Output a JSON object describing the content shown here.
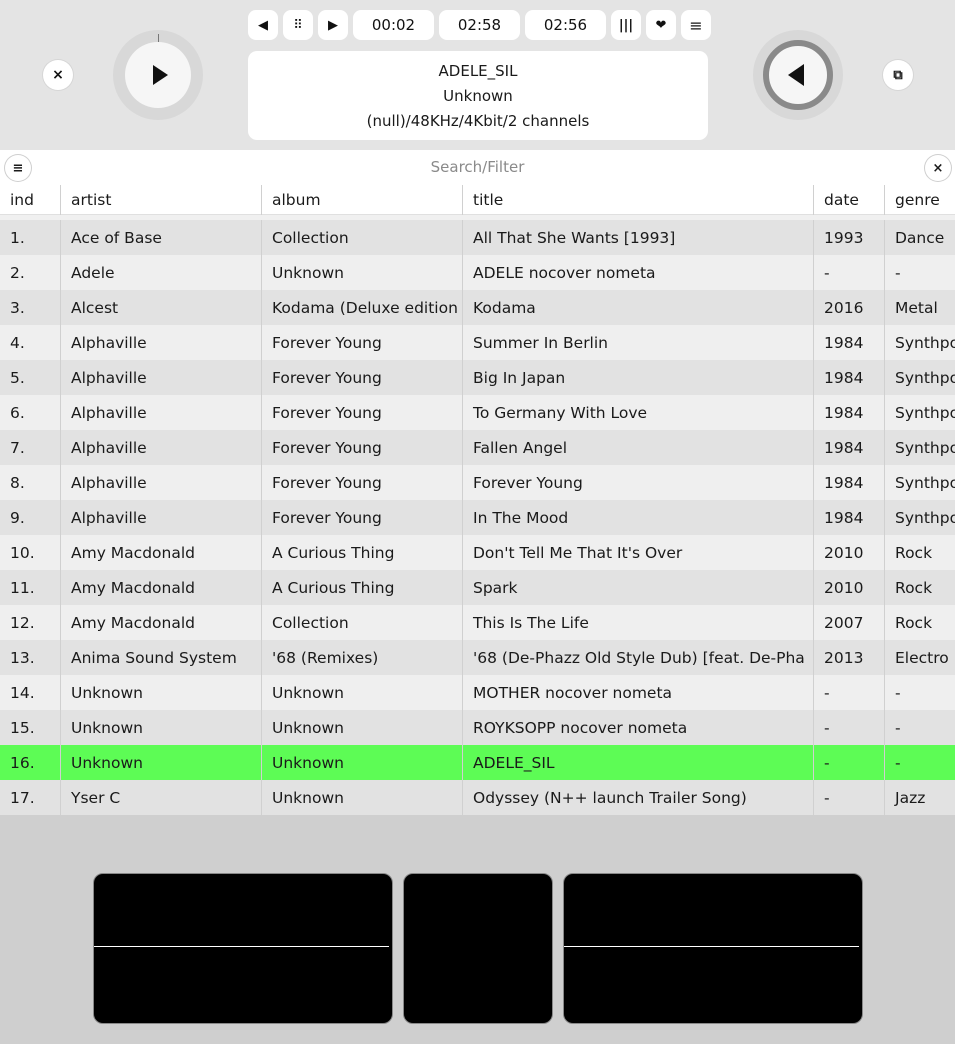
{
  "player": {
    "times": {
      "elapsed": "00:02",
      "total": "02:58",
      "remaining": "02:56"
    },
    "track_title": "ADELE_SIL",
    "track_album": "Unknown",
    "track_format": "(null)/48KHz/4Kbit/2 channels",
    "icons": {
      "close": "×",
      "prev": "◀",
      "drag": "⠿",
      "next": "▶",
      "bars": "|||",
      "heart": "❤",
      "menu": "≡",
      "window": "⧉"
    }
  },
  "search": {
    "placeholder": "Search/Filter",
    "menu_icon": "≡",
    "clear_icon": "×"
  },
  "table": {
    "columns": [
      "ind",
      "artist",
      "album",
      "title",
      "date",
      "genre"
    ],
    "rows": [
      {
        "ind": "1.",
        "artist": "Ace of Base",
        "album": "Collection",
        "title": "All That She Wants [1993]",
        "date": "1993",
        "genre": "Dance"
      },
      {
        "ind": "2.",
        "artist": "Adele",
        "album": "Unknown",
        "title": "ADELE nocover nometa",
        "date": "-",
        "genre": "-"
      },
      {
        "ind": "3.",
        "artist": "Alcest",
        "album": "Kodama (Deluxe edition",
        "title": "Kodama",
        "date": "2016",
        "genre": "Metal"
      },
      {
        "ind": "4.",
        "artist": "Alphaville",
        "album": "Forever Young",
        "title": "Summer In Berlin",
        "date": "1984",
        "genre": "Synthpo"
      },
      {
        "ind": "5.",
        "artist": "Alphaville",
        "album": "Forever Young",
        "title": "Big In Japan",
        "date": "1984",
        "genre": "Synthpo"
      },
      {
        "ind": "6.",
        "artist": "Alphaville",
        "album": "Forever Young",
        "title": "To Germany With Love",
        "date": "1984",
        "genre": "Synthpo"
      },
      {
        "ind": "7.",
        "artist": "Alphaville",
        "album": "Forever Young",
        "title": "Fallen Angel",
        "date": "1984",
        "genre": "Synthpo"
      },
      {
        "ind": "8.",
        "artist": "Alphaville",
        "album": "Forever Young",
        "title": "Forever Young",
        "date": "1984",
        "genre": "Synthpo"
      },
      {
        "ind": "9.",
        "artist": "Alphaville",
        "album": "Forever Young",
        "title": "In The Mood",
        "date": "1984",
        "genre": "Synthpo"
      },
      {
        "ind": "10.",
        "artist": "Amy Macdonald",
        "album": "A Curious Thing",
        "title": "Don't Tell Me That It's Over",
        "date": "2010",
        "genre": "Rock"
      },
      {
        "ind": "11.",
        "artist": "Amy Macdonald",
        "album": "A Curious Thing",
        "title": "Spark",
        "date": "2010",
        "genre": "Rock"
      },
      {
        "ind": "12.",
        "artist": "Amy Macdonald",
        "album": "Collection",
        "title": "This Is The Life",
        "date": "2007",
        "genre": "Rock"
      },
      {
        "ind": "13.",
        "artist": "Anima Sound System",
        "album": "'68 (Remixes)",
        "title": "'68 (De-Phazz Old Style Dub) [feat. De-Pha",
        "date": "2013",
        "genre": "Electro"
      },
      {
        "ind": "14.",
        "artist": "Unknown",
        "album": "Unknown",
        "title": "MOTHER nocover nometa",
        "date": "-",
        "genre": "-"
      },
      {
        "ind": "15.",
        "artist": "Unknown",
        "album": "Unknown",
        "title": "ROYKSOPP nocover nometa",
        "date": "-",
        "genre": "-"
      },
      {
        "ind": "16.",
        "artist": "Unknown",
        "album": "Unknown",
        "title": "ADELE_SIL",
        "date": "-",
        "genre": "-"
      },
      {
        "ind": "17.",
        "artist": "Yser C",
        "album": "Unknown",
        "title": "Odyssey (N++ launch Trailer Song)",
        "date": "-",
        "genre": "Jazz"
      }
    ],
    "active_row_index": 15
  },
  "colors": {
    "active_row": "#5dfc55",
    "background": "#cfcfcf",
    "visualizer": "#000000"
  }
}
